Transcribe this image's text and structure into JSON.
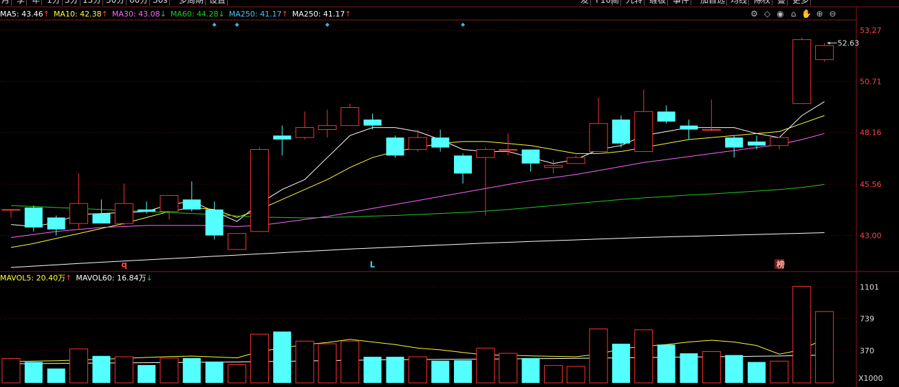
{
  "toolbar": {
    "left_tabs": [
      "月",
      "季",
      "年",
      "1分",
      "5分",
      "15分",
      "30分",
      "60分",
      "30s",
      "多周期",
      "设置"
    ],
    "right_tabs": [
      "发",
      "F10",
      "简",
      "九转",
      "缠板",
      "事件",
      "加自选",
      "均线",
      "除权",
      "叠",
      "更多"
    ]
  },
  "ma_legend": [
    {
      "label": "MA5: 43.46",
      "arrow": "↑",
      "color": "#ffffff"
    },
    {
      "label": "MA10: 42.38",
      "arrow": "↑",
      "color": "#ffff3a"
    },
    {
      "label": "MA30: 43.08",
      "arrow": "↓",
      "color": "#ff66ff"
    },
    {
      "label": "MA60: 44.28",
      "arrow": "↓",
      "color": "#22cc22"
    },
    {
      "label": "MA250: 41.17",
      "arrow": "↑",
      "color": "#4fc3f7"
    },
    {
      "label": "MA250: 41.17",
      "arrow": "↑",
      "color": "#ffffff"
    }
  ],
  "vol_legend": [
    {
      "label": "MAVOL5: 20.40万",
      "arrow": "↑",
      "color": "#ffff3a"
    },
    {
      "label": "MAVOL60: 16.84万",
      "arrow": "↓",
      "color": "#ffffff"
    }
  ],
  "tool_icons": [
    "settings-icon",
    "diamond-icon",
    "eye-icon",
    "basket-icon",
    "hand-icon",
    "zoom-in-icon",
    "zoom-out-icon"
  ],
  "tool_glyphs": [
    "⚙",
    "◇",
    "◉",
    "⌂",
    "✋",
    "⊕",
    "⊖"
  ],
  "chart_data": {
    "type": "candlestick",
    "price_axis": {
      "ticks": [
        53.27,
        50.71,
        48.16,
        45.56,
        43.0
      ],
      "range": [
        41.3,
        53.75
      ]
    },
    "volume_axis": {
      "ticks": [
        "1101",
        "739",
        "370"
      ],
      "unit_label": "X1000",
      "range": [
        0,
        1130
      ]
    },
    "max_annotation": "52.63",
    "markers": [
      {
        "text": "q",
        "candle": 5,
        "color": "#ff4444"
      },
      {
        "text": "L",
        "candle": 16,
        "color": "#4fc3f7"
      },
      {
        "text": "榜",
        "candle": 34,
        "color": "#ffaaaa"
      }
    ],
    "event_diamond_candles": [
      9,
      10,
      14,
      20
    ],
    "candles": [
      {
        "o": 44.3,
        "h": 44.3,
        "l": 43.9,
        "c": 44.3
      },
      {
        "o": 44.4,
        "h": 44.5,
        "l": 43.2,
        "c": 43.4
      },
      {
        "o": 43.9,
        "h": 44.0,
        "l": 43.0,
        "c": 43.3
      },
      {
        "o": 43.6,
        "h": 46.1,
        "l": 43.3,
        "c": 44.6
      },
      {
        "o": 44.1,
        "h": 44.8,
        "l": 43.6,
        "c": 43.6
      },
      {
        "o": 43.6,
        "h": 45.6,
        "l": 43.5,
        "c": 44.6
      },
      {
        "o": 44.3,
        "h": 44.7,
        "l": 44.1,
        "c": 44.2
      },
      {
        "o": 44.2,
        "h": 45.0,
        "l": 43.8,
        "c": 45.0
      },
      {
        "o": 44.8,
        "h": 45.7,
        "l": 44.2,
        "c": 44.3
      },
      {
        "o": 44.3,
        "h": 44.7,
        "l": 42.8,
        "c": 43.0
      },
      {
        "o": 42.3,
        "h": 43.1,
        "l": 42.3,
        "c": 43.1
      },
      {
        "o": 43.2,
        "h": 47.4,
        "l": 43.2,
        "c": 47.3
      },
      {
        "o": 48.0,
        "h": 48.5,
        "l": 47.0,
        "c": 47.8
      },
      {
        "o": 47.9,
        "h": 49.2,
        "l": 47.8,
        "c": 48.4
      },
      {
        "o": 48.3,
        "h": 49.3,
        "l": 47.9,
        "c": 48.5
      },
      {
        "o": 48.5,
        "h": 49.6,
        "l": 48.5,
        "c": 49.4
      },
      {
        "o": 48.8,
        "h": 49.1,
        "l": 48.3,
        "c": 48.5
      },
      {
        "o": 47.9,
        "h": 48.0,
        "l": 46.9,
        "c": 47.0
      },
      {
        "o": 47.3,
        "h": 48.3,
        "l": 47.2,
        "c": 47.9
      },
      {
        "o": 47.9,
        "h": 48.3,
        "l": 47.2,
        "c": 47.4
      },
      {
        "o": 47.0,
        "h": 47.1,
        "l": 45.6,
        "c": 46.1
      },
      {
        "o": 46.9,
        "h": 47.4,
        "l": 44.0,
        "c": 47.3
      },
      {
        "o": 47.3,
        "h": 48.1,
        "l": 47.0,
        "c": 47.3
      },
      {
        "o": 47.3,
        "h": 47.3,
        "l": 46.2,
        "c": 46.6
      },
      {
        "o": 46.4,
        "h": 46.8,
        "l": 46.1,
        "c": 46.5
      },
      {
        "o": 46.6,
        "h": 47.0,
        "l": 46.6,
        "c": 46.9
      },
      {
        "o": 47.2,
        "h": 49.9,
        "l": 47.2,
        "c": 48.6
      },
      {
        "o": 48.8,
        "h": 49.0,
        "l": 47.4,
        "c": 47.6
      },
      {
        "o": 47.2,
        "h": 50.3,
        "l": 47.2,
        "c": 49.2
      },
      {
        "o": 49.2,
        "h": 49.5,
        "l": 48.6,
        "c": 48.7
      },
      {
        "o": 48.5,
        "h": 48.8,
        "l": 47.8,
        "c": 48.3
      },
      {
        "o": 48.3,
        "h": 49.8,
        "l": 48.2,
        "c": 48.3
      },
      {
        "o": 47.9,
        "h": 48.0,
        "l": 46.9,
        "c": 47.4
      },
      {
        "o": 47.7,
        "h": 48.0,
        "l": 47.3,
        "c": 47.5
      },
      {
        "o": 47.5,
        "h": 47.8,
        "l": 47.3,
        "c": 47.9
      },
      {
        "o": 49.6,
        "h": 52.9,
        "l": 49.6,
        "c": 52.8
      },
      {
        "o": 51.8,
        "h": 52.63,
        "l": 51.7,
        "c": 52.5
      }
    ],
    "volume": [
      280,
      240,
      165,
      390,
      310,
      300,
      205,
      285,
      285,
      245,
      210,
      560,
      590,
      480,
      450,
      480,
      300,
      300,
      300,
      255,
      260,
      400,
      340,
      285,
      200,
      190,
      620,
      450,
      610,
      440,
      340,
      360,
      320,
      240,
      250,
      1110,
      820
    ],
    "series": [
      {
        "name": "MA5",
        "color": "#ffffff",
        "values": [
          43.55,
          43.45,
          43.65,
          44.05,
          44.1,
          44.15,
          44.2,
          44.55,
          44.7,
          44.2,
          43.7,
          44.6,
          45.3,
          45.8,
          46.9,
          48.0,
          48.4,
          48.4,
          48.2,
          47.8,
          47.3,
          47.2,
          47.2,
          46.9,
          46.6,
          46.8,
          47.3,
          47.5,
          48.0,
          48.2,
          48.4,
          48.4,
          48.4,
          48.1,
          47.9,
          49.0,
          49.7
        ]
      },
      {
        "name": "MA10",
        "color": "#ffff3a",
        "values": [
          42.4,
          42.6,
          42.85,
          43.1,
          43.35,
          43.6,
          43.9,
          44.2,
          44.4,
          44.3,
          43.9,
          44.3,
          44.8,
          45.3,
          45.8,
          46.4,
          46.9,
          47.2,
          47.4,
          47.6,
          47.7,
          47.7,
          47.6,
          47.5,
          47.3,
          47.1,
          47.1,
          47.2,
          47.4,
          47.6,
          47.8,
          47.9,
          48.0,
          48.1,
          48.2,
          48.6,
          49.0
        ]
      },
      {
        "name": "MA30",
        "color": "#ff66ff",
        "values": [
          42.9,
          43.05,
          43.2,
          43.3,
          43.4,
          43.45,
          43.5,
          43.5,
          43.5,
          43.5,
          43.45,
          43.5,
          43.65,
          43.8,
          43.95,
          44.15,
          44.35,
          44.55,
          44.75,
          44.95,
          45.15,
          45.35,
          45.55,
          45.75,
          45.9,
          46.05,
          46.25,
          46.45,
          46.65,
          46.8,
          46.95,
          47.1,
          47.25,
          47.4,
          47.55,
          47.8,
          48.1
        ]
      },
      {
        "name": "MA60",
        "color": "#22cc22",
        "values": [
          44.5,
          44.45,
          44.4,
          44.35,
          44.3,
          44.25,
          44.2,
          44.15,
          44.1,
          44.05,
          43.98,
          43.92,
          43.9,
          43.88,
          43.9,
          43.93,
          43.97,
          44.0,
          44.05,
          44.1,
          44.15,
          44.22,
          44.3,
          44.4,
          44.5,
          44.6,
          44.7,
          44.8,
          44.88,
          44.95,
          45.02,
          45.08,
          45.15,
          45.22,
          45.3,
          45.4,
          45.55
        ]
      },
      {
        "name": "MA250",
        "color": "#ffffff",
        "values": [
          41.4,
          41.47,
          41.53,
          41.6,
          41.66,
          41.72,
          41.78,
          41.84,
          41.9,
          41.96,
          42.02,
          42.08,
          42.14,
          42.2,
          42.26,
          42.32,
          42.37,
          42.42,
          42.47,
          42.52,
          42.57,
          42.62,
          42.66,
          42.7,
          42.74,
          42.78,
          42.82,
          42.86,
          42.9,
          42.93,
          42.96,
          42.99,
          43.02,
          43.05,
          43.08,
          43.11,
          43.14
        ]
      },
      {
        "name": "MAVOL5",
        "color": "#ffff3a",
        "values": [
          245,
          250,
          255,
          262,
          270,
          282,
          292,
          302,
          308,
          298,
          288,
          360,
          400,
          440,
          465,
          500,
          470,
          440,
          400,
          380,
          350,
          320,
          320,
          310,
          305,
          300,
          330,
          390,
          420,
          440,
          470,
          490,
          470,
          430,
          330,
          380,
          510
        ]
      },
      {
        "name": "MAVOL60",
        "color": "#ffffff",
        "values": [
          220,
          222,
          224,
          226,
          228,
          230,
          232,
          234,
          236,
          238,
          240,
          244,
          248,
          252,
          256,
          260,
          263,
          266,
          268,
          270,
          272,
          274,
          276,
          278,
          280,
          282,
          285,
          288,
          291,
          294,
          297,
          300,
          303,
          306,
          309,
          315,
          320
        ]
      }
    ]
  }
}
